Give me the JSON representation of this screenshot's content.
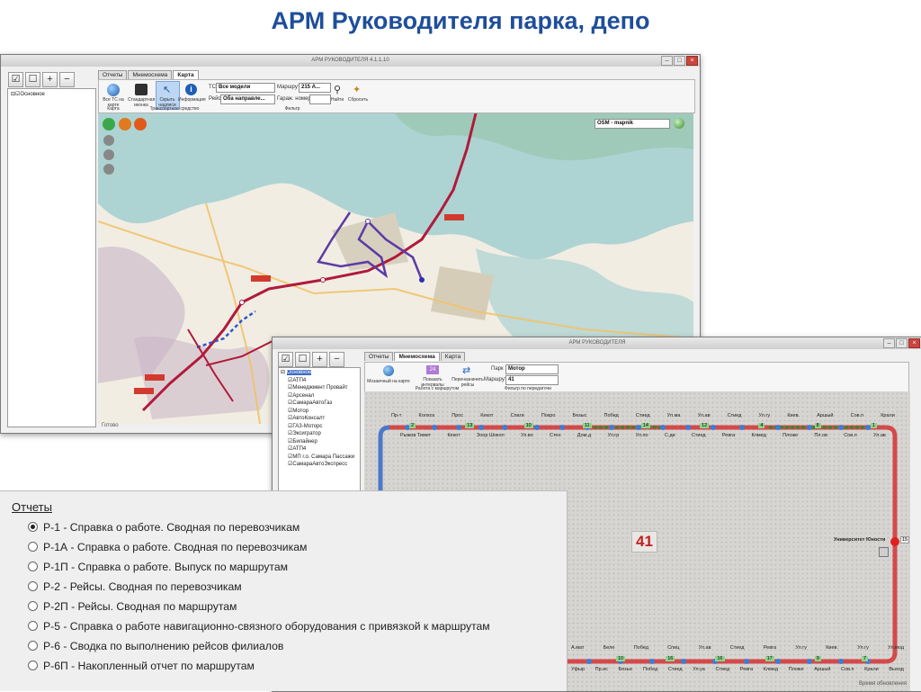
{
  "slide": {
    "title": "АРМ Руководителя парка, депо"
  },
  "map_window": {
    "title": "АРМ РУКОВОДИТЕЛЯ 4.1.1.10",
    "toolbar": [
      "☑",
      "☐",
      "+",
      "−"
    ],
    "tree": {
      "root": "Основное"
    },
    "tabs": [
      "Отчеты",
      "Мнемосхема",
      "Карта"
    ],
    "active_tab": "Карта",
    "ribbon": {
      "buttons": [
        "Все ТС на карте",
        "Стандартная иконка",
        "Скрыть надписи",
        "Информация"
      ],
      "group_left": "Карта",
      "group_mid": "Транспортное средство",
      "group_right": "Фильтр",
      "ts_label": "ТС",
      "ts_value": "Все модели",
      "route_label": "Маршрут",
      "route_value": "215 А...",
      "reys_label": "Рейс",
      "reys_value": "Оба направле...",
      "garage_label": "Гараж. номер",
      "find_label": "Найти",
      "reset_label": "Сбросить"
    },
    "map_provider": "OSM - mapnik",
    "status": "Готово",
    "colors": {
      "water": "#aed3d3",
      "land": "#f1ede3",
      "route_red": "#b01a3b",
      "route_purple": "#5b3aa6"
    }
  },
  "mnemo_window": {
    "title": "АРМ РУКОВОДИТЕЛЯ",
    "toolbar": [
      "☑",
      "☐",
      "+",
      "−"
    ],
    "tree": [
      "Основное",
      "АТП4",
      "Менеджмент Провайт",
      "Арсенал",
      "СамараАвтоГаз",
      "Мотор",
      "АвтоКонсалт",
      "ГАЗ-Моторс",
      "Эксигратор",
      "Билайнер",
      "АТП4",
      "МП г.о. Самара Пассажи",
      "СамараАвтоЭкспресс"
    ],
    "tabs": [
      "Отчеты",
      "Мнемосхема",
      "Карта"
    ],
    "active_tab": "Мнемосхема",
    "ribbon": {
      "btn1": "Мозаичный на карте",
      "btn2": "Показать интервалы",
      "btn2_value": "24",
      "btn3": "Переназначить рейсы",
      "group1": "Работа с маршрутом",
      "group2": "Фильтр по передаточи",
      "park_label": "Парк",
      "park_value": "Мотор",
      "route_label": "Маршрут",
      "route_value": "41"
    },
    "route_number": "41",
    "terminal": "Университет Юности",
    "terminal_badge": "15",
    "top_stops": [
      "Пр-т",
      "Колхоз",
      "Прос",
      "Кекот",
      "Спаги",
      "Покро",
      "Безыс",
      "Побед",
      "Стиед",
      "Ул.ма",
      "Ул.ав",
      "Стиед",
      "Ул.гу",
      "Киев.",
      "Аршый",
      "Сов.п",
      "Крали"
    ],
    "top_stops_lower": [
      "Рыжов Тимет",
      "Кекот",
      "Зоор Шокол",
      "Ул.во",
      "Стен",
      "Дом.д",
      "Ул.гр",
      "Ул.по",
      "С.ди",
      "Стиед",
      "Ревга",
      "Клмед",
      "Пложе",
      "Пл.ов",
      "Сов.п",
      "Ул.ав"
    ],
    "top_badges": [
      "2",
      "13",
      "10",
      "11",
      "14",
      "12",
      "4",
      "8",
      "1"
    ],
    "bottom_stops": [
      "А.мат",
      "Беле",
      "Побед",
      "Спиц",
      "Ул.ав",
      "Стиед",
      "Ревга",
      "Ул.гу",
      "Киев.",
      "Ул.гу",
      "Ул.мод"
    ],
    "bottom_stops_lower": [
      "Уфыр",
      "Пр.ис",
      "Безыс",
      "Побед",
      "Стиед",
      "Ул.уа",
      "Стиед",
      "Ревга",
      "Клмед",
      "Пложе",
      "Аршый",
      "Сов.п",
      "Крали",
      "Выход"
    ],
    "bottom_badges": [
      "10",
      "16",
      "16",
      "17",
      "9",
      "7"
    ],
    "status": "Время обновления",
    "colors": {
      "track_red": "#d44a4a",
      "track_blue": "#4c78c8",
      "track_green": "#2e8b2e",
      "stop": "#3c7dd6"
    }
  },
  "reports": {
    "title": "Отчеты",
    "items": [
      {
        "code": "Р-1",
        "text": "Р-1 - Справка о работе. Сводная по перевозчикам",
        "selected": true
      },
      {
        "code": "Р-1А",
        "text": "Р-1А - Справка о работе. Сводная по перевозчикам",
        "selected": false
      },
      {
        "code": "Р-1П",
        "text": "Р-1П - Справка о работе. Выпуск по маршрутам",
        "selected": false
      },
      {
        "code": "Р-2",
        "text": "Р-2 - Рейсы. Сводная по перевозчикам",
        "selected": false
      },
      {
        "code": "Р-2П",
        "text": "Р-2П - Рейсы. Сводная по маршрутам",
        "selected": false
      },
      {
        "code": "Р-5",
        "text": "Р-5 - Справка о работе навигационно-связного оборудования с привязкой к маршрутам",
        "selected": false
      },
      {
        "code": "Р-6",
        "text": "Р-6 - Сводка по выполнению рейсов филиалов",
        "selected": false
      },
      {
        "code": "Р-6П",
        "text": "Р-6П - Накопленный отчет по маршрутам",
        "selected": false
      }
    ]
  }
}
